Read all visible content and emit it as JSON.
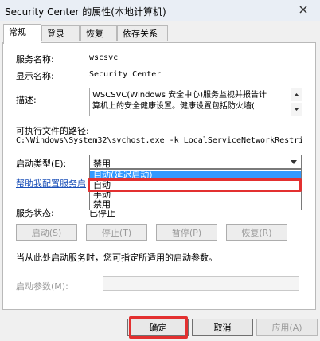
{
  "window": {
    "title": "Security Center 的属性(本地计算机)"
  },
  "tabs": [
    {
      "label": "常规",
      "active": true
    },
    {
      "label": "登录",
      "active": false
    },
    {
      "label": "恢复",
      "active": false
    },
    {
      "label": "依存关系",
      "active": false
    }
  ],
  "general": {
    "service_name_label": "服务名称:",
    "service_name_value": "wscsvc",
    "display_name_label": "显示名称:",
    "display_name_value": "Security Center",
    "description_label": "描述:",
    "description_text": "WSCSVC(Windows 安全中心)服务监视并报告计\n算机上的安全健康设置。健康设置包括防火墙(",
    "executable_label": "可执行文件的路径:",
    "executable_path": "C:\\Windows\\System32\\svchost.exe -k LocalServiceNetworkRestri",
    "startup_type_label": "启动类型(E):",
    "startup_type_selected": "禁用",
    "startup_options": [
      "自动(延迟启动)",
      "自动",
      "手动",
      "禁用"
    ],
    "help_link": "帮助我配置服务启",
    "service_status_label": "服务状态:",
    "service_status_value": "已停止",
    "buttons": {
      "start": "启动(S)",
      "stop": "停止(T)",
      "pause": "暂停(P)",
      "resume": "恢复(R)"
    },
    "note_text": "当从此处启动服务时，您可指定所适用的启动参数。",
    "start_params_label": "启动参数(M):",
    "start_params_value": ""
  },
  "footer": {
    "ok": "确定",
    "cancel": "取消",
    "apply": "应用(A)"
  }
}
